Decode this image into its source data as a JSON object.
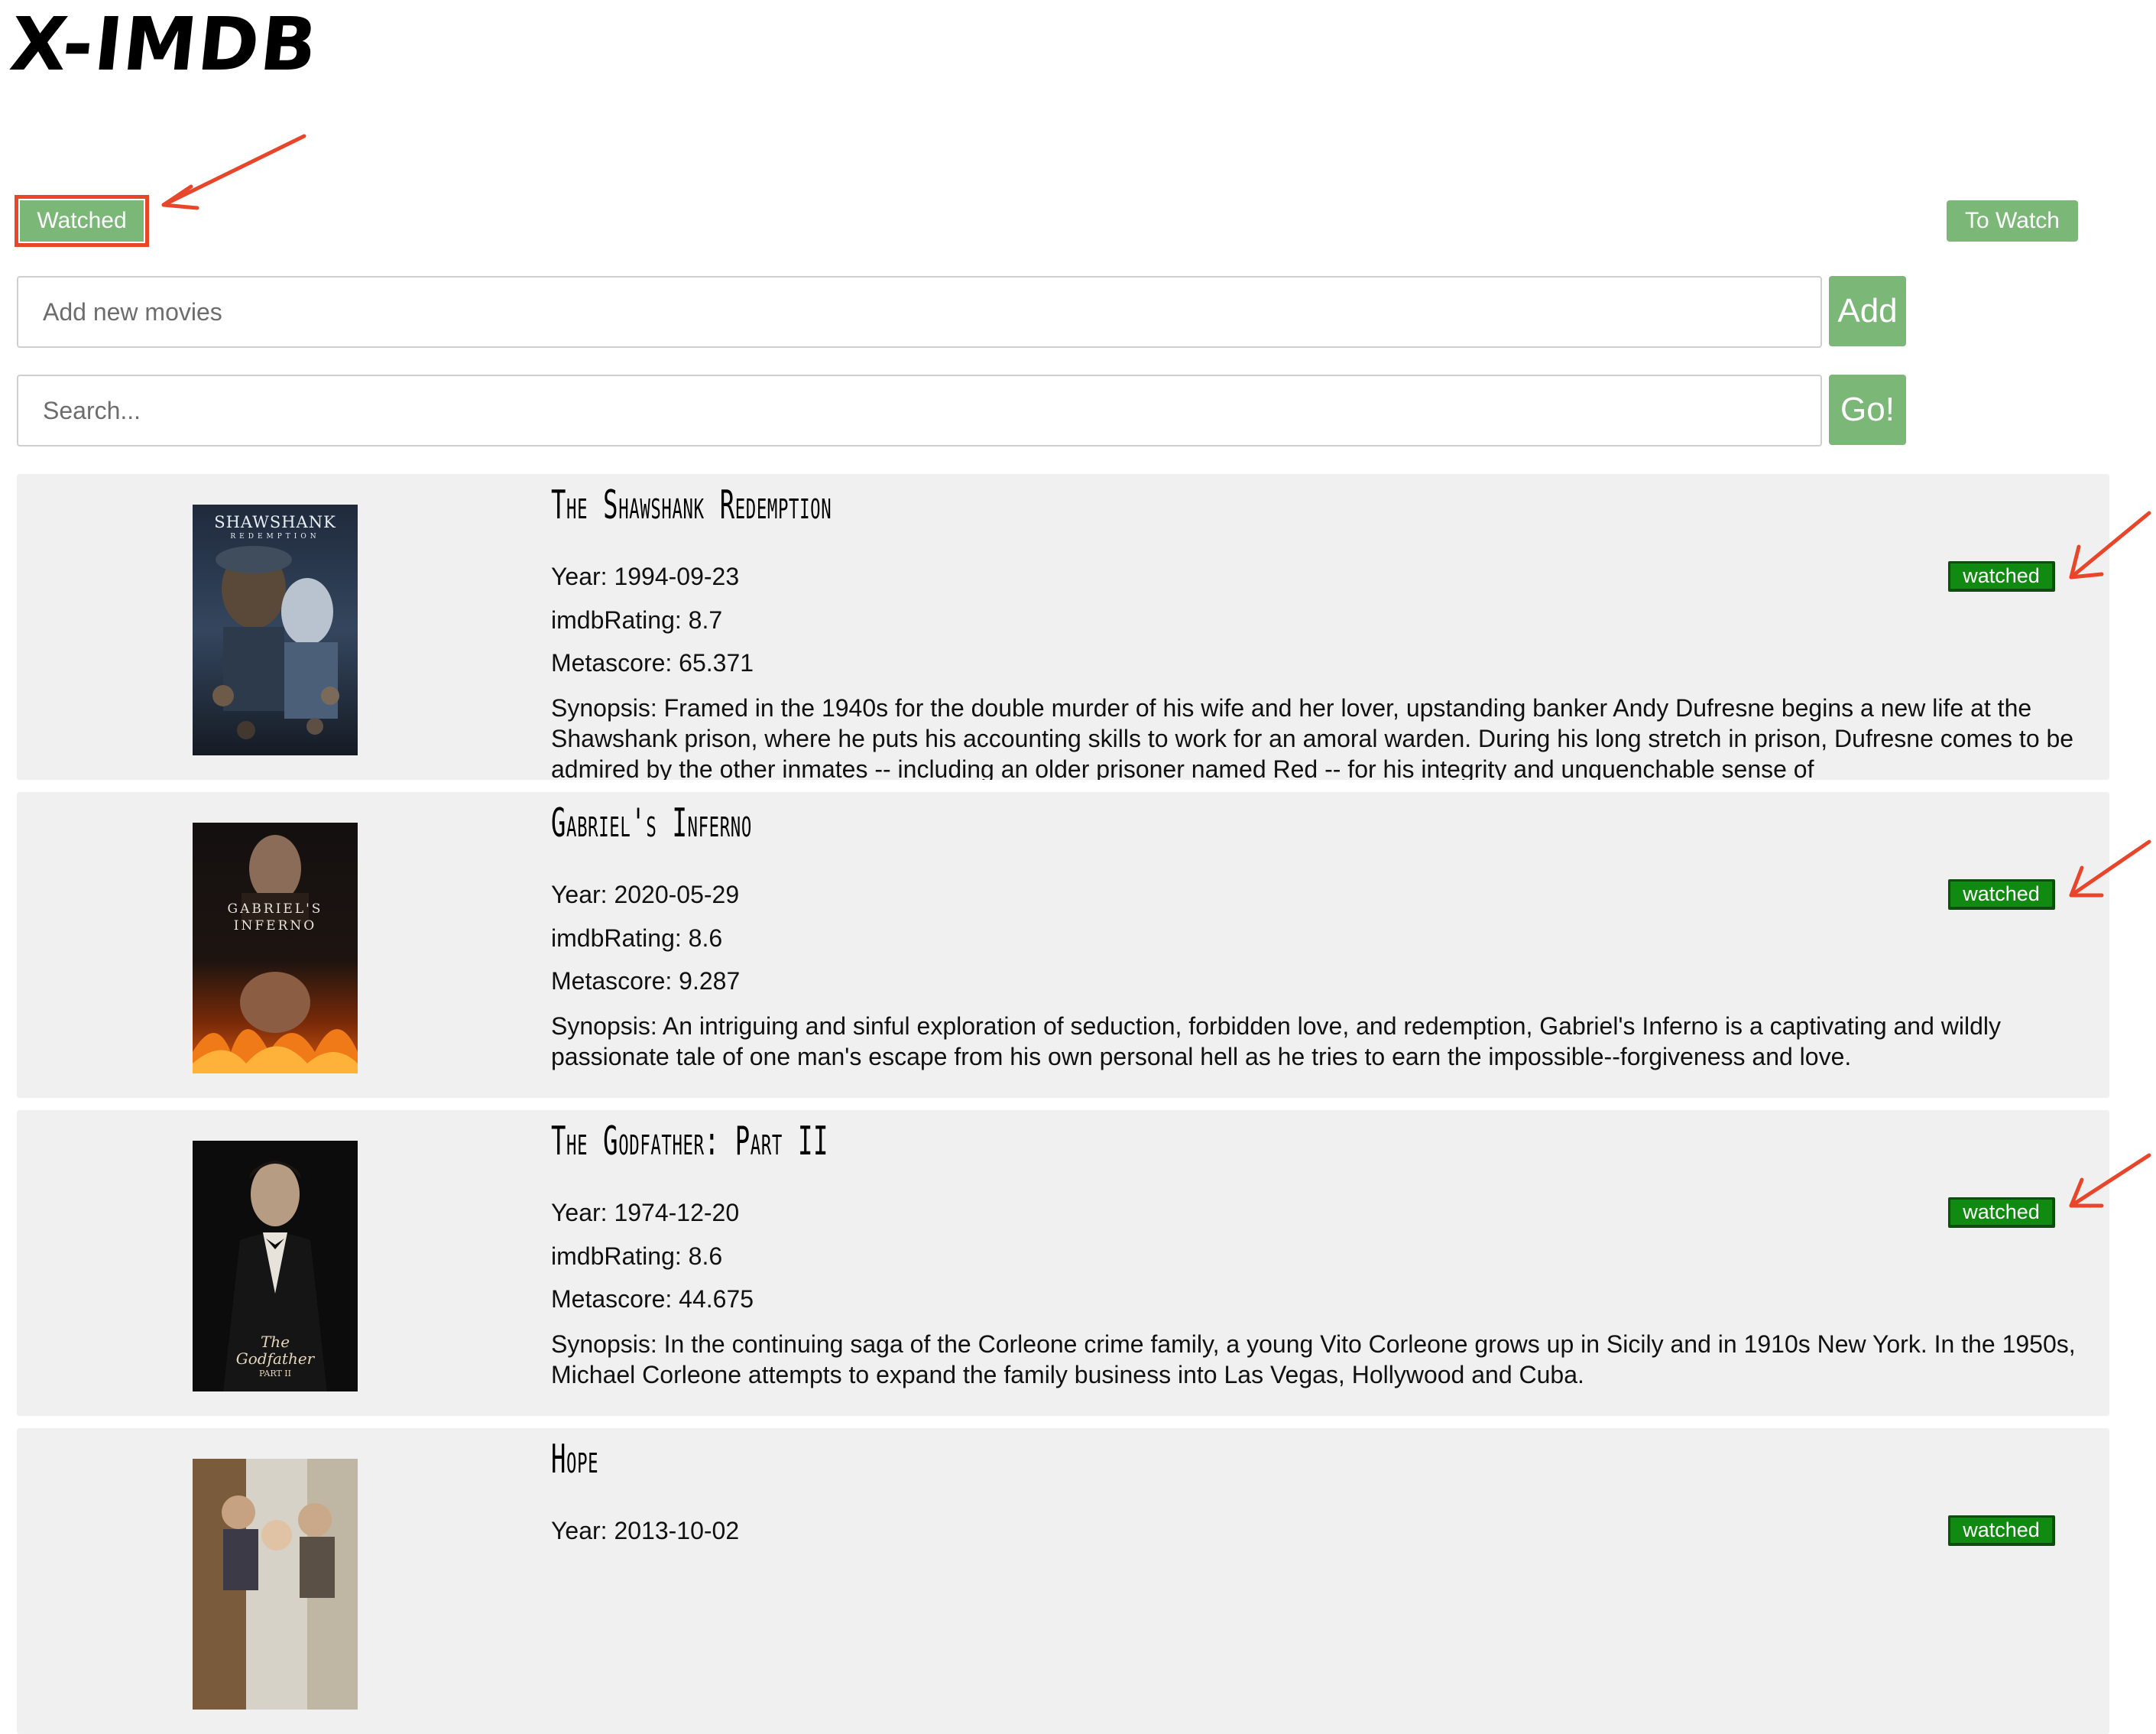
{
  "app": {
    "title": "X-IMDB"
  },
  "tabs": {
    "watched_label": "Watched",
    "to_watch_label": "To Watch"
  },
  "add_movie": {
    "placeholder": "Add new movies",
    "button_label": "Add"
  },
  "search": {
    "placeholder": "Search...",
    "button_label": "Go!"
  },
  "movies": [
    {
      "title": "The Shawshank Redemption",
      "year": "Year: 1994-09-23",
      "imdb_rating": "imdbRating: 8.7",
      "metascore": "Metascore: 65.371",
      "synopsis": "Synopsis: Framed in the 1940s for the double murder of his wife and her lover, upstanding banker Andy Dufresne begins a new life at the Shawshank prison, where he puts his accounting skills to work for an amoral warden. During his long stretch in prison, Dufresne comes to be admired by the other inmates -- including an older prisoner named Red -- for his integrity and unquenchable sense of",
      "status_label": "watched",
      "poster_text": "THE SHAWSHANK REDEMPTION"
    },
    {
      "title": "Gabriel's Inferno",
      "year": "Year: 2020-05-29",
      "imdb_rating": "imdbRating: 8.6",
      "metascore": "Metascore: 9.287",
      "synopsis": "Synopsis: An intriguing and sinful exploration of seduction, forbidden love, and redemption, Gabriel's Inferno is a captivating and wildly passionate tale of one man's escape from his own personal hell as he tries to earn the impossible--forgiveness and love.",
      "status_label": "watched",
      "poster_text": "GABRIEL'S INFERNO"
    },
    {
      "title": "The Godfather: Part II",
      "year": "Year: 1974-12-20",
      "imdb_rating": "imdbRating: 8.6",
      "metascore": "Metascore: 44.675",
      "synopsis": "Synopsis: In the continuing saga of the Corleone crime family, a young Vito Corleone grows up in Sicily and in 1910s New York. In the 1950s, Michael Corleone attempts to expand the family business into Las Vegas, Hollywood and Cuba.",
      "status_label": "watched",
      "poster_text": "The Godfather PART II"
    },
    {
      "title": "Hope",
      "year": "Year: 2013-10-02",
      "imdb_rating": "",
      "metascore": "",
      "synopsis": "",
      "status_label": "watched",
      "poster_text": ""
    }
  ],
  "colors": {
    "tab_green": "#7bb878",
    "status_green": "#118a11",
    "annotation_red": "#e8462a",
    "card_background": "#f0f0f0"
  }
}
